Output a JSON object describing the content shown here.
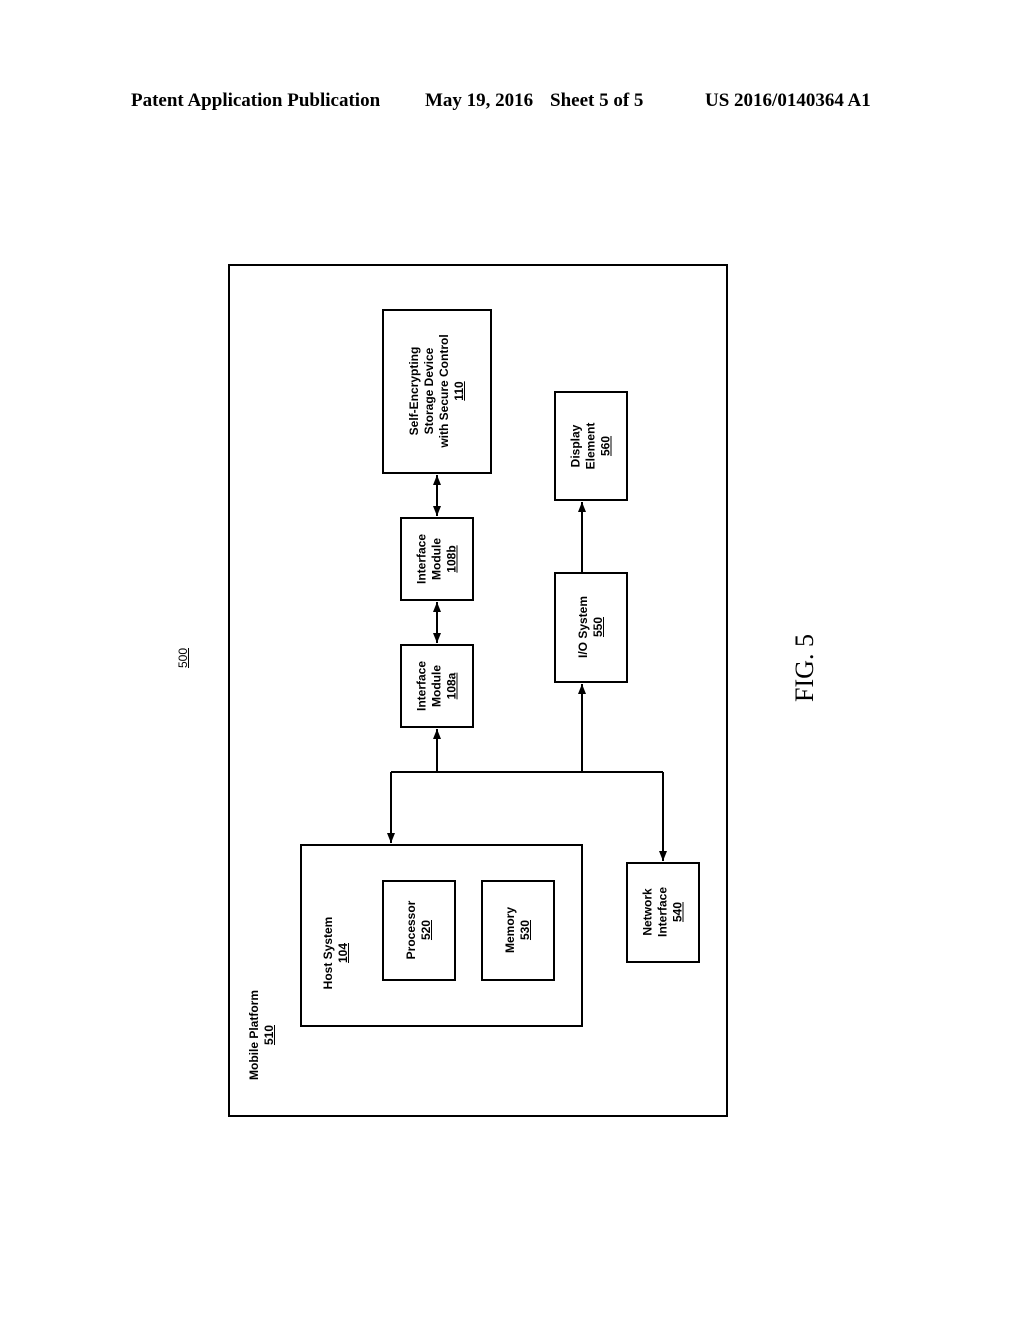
{
  "header": {
    "left": "Patent Application Publication",
    "date": "May 19, 2016",
    "sheet": "Sheet 5 of 5",
    "number": "US 2016/0140364 A1"
  },
  "figure": {
    "label": "FIG. 5",
    "ref": "500"
  },
  "blocks": {
    "mobile_platform": {
      "lines": [
        "Mobile Platform"
      ],
      "ref": "510"
    },
    "host_system": {
      "lines": [
        "Host System"
      ],
      "ref": "104"
    },
    "processor": {
      "lines": [
        "Processor"
      ],
      "ref": "520"
    },
    "memory": {
      "lines": [
        "Memory"
      ],
      "ref": "530"
    },
    "network_interface": {
      "lines": [
        "Network",
        "Interface"
      ],
      "ref": "540"
    },
    "io_system": {
      "lines": [
        "I/O System"
      ],
      "ref": "550"
    },
    "display_element": {
      "lines": [
        "Display",
        "Element"
      ],
      "ref": "560"
    },
    "interface_a": {
      "lines": [
        "Interface",
        "Module"
      ],
      "ref": "108a"
    },
    "interface_b": {
      "lines": [
        "Interface",
        "Module"
      ],
      "ref": "108b"
    },
    "storage": {
      "lines": [
        "Self-Encrypting",
        "Storage Device",
        "with Secure Control"
      ],
      "ref": "110"
    }
  }
}
